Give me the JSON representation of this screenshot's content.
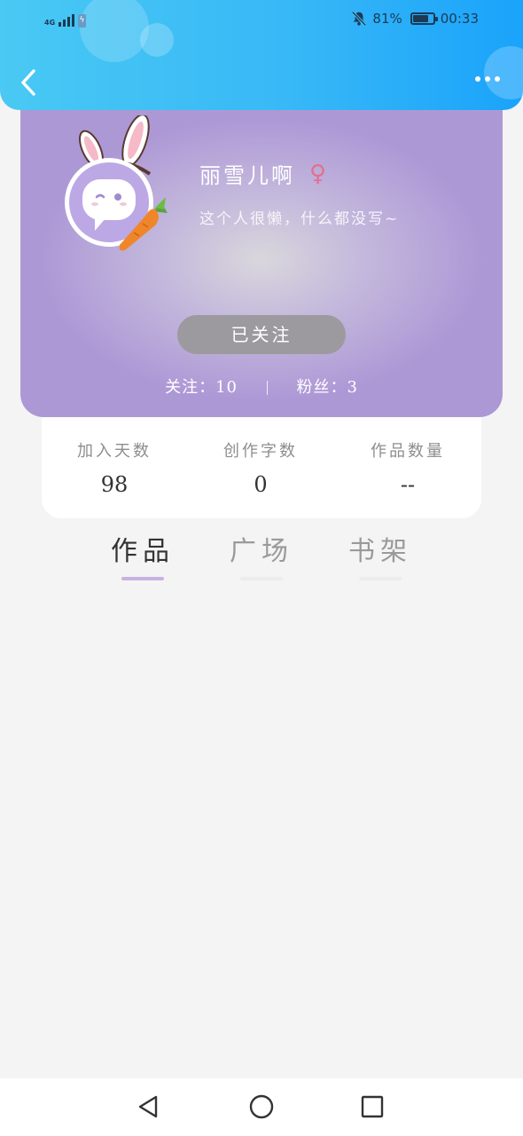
{
  "status_bar": {
    "network": "4G",
    "battery_percent": "81%",
    "battery_level": 0.81,
    "time": "00:33"
  },
  "header": {
    "back_icon": "chevron-left-icon",
    "more_icon": "more-horizontal-icon",
    "bg_color": "#38b8f6"
  },
  "profile": {
    "username": "丽雪儿啊",
    "gender_icon": "♀",
    "bio": "这个人很懒，什么都没写~",
    "follow_label": "已关注",
    "following_label": "关注：",
    "following_count": "10",
    "fans_label": "粉丝：",
    "fans_count": "3",
    "accent_color": "#ad98d6"
  },
  "info": [
    {
      "label": "加入天数",
      "value": "98"
    },
    {
      "label": "创作字数",
      "value": "0"
    },
    {
      "label": "作品数量",
      "value": "--"
    }
  ],
  "tabs": [
    {
      "label": "作品",
      "active": true
    },
    {
      "label": "广场",
      "active": false
    },
    {
      "label": "书架",
      "active": false
    }
  ],
  "nav": {
    "back_icon": "triangle-back-icon",
    "home_icon": "circle-home-icon",
    "recents_icon": "square-recents-icon"
  }
}
